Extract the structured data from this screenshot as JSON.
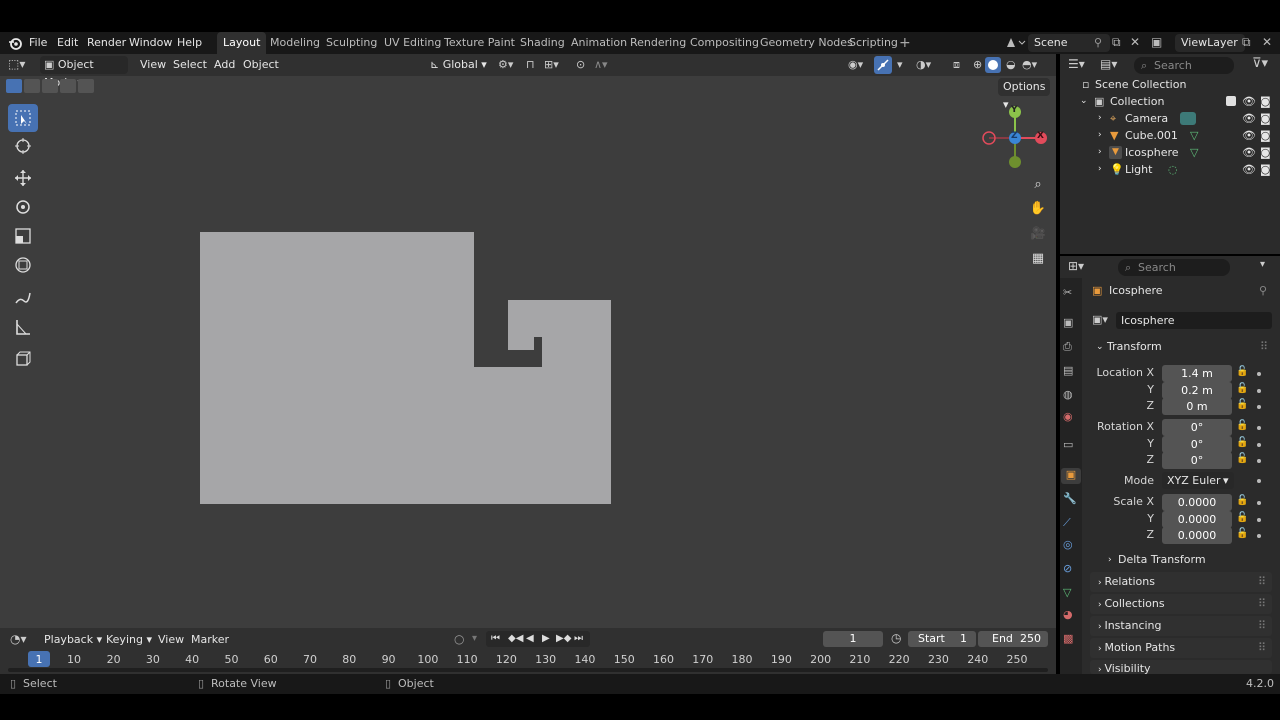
{
  "topmenu": {
    "items": [
      "File",
      "Edit",
      "Render",
      "Window",
      "Help"
    ],
    "workspaces": [
      "Layout",
      "Modeling",
      "Sculpting",
      "UV Editing",
      "Texture Paint",
      "Shading",
      "Animation",
      "Rendering",
      "Compositing",
      "Geometry Nodes",
      "Scripting"
    ],
    "active_workspace": "Layout",
    "scene": "Scene",
    "view_layer": "ViewLayer"
  },
  "viewport": {
    "mode": "Object Mode",
    "menus": [
      "View",
      "Select",
      "Add",
      "Object"
    ],
    "transform_orientation": "Global",
    "options_label": "Options"
  },
  "outliner": {
    "search_placeholder": "Search",
    "scene_collection": "Scene Collection",
    "collection": "Collection",
    "objects": [
      "Camera",
      "Cube.001",
      "Icosphere",
      "Light"
    ]
  },
  "properties": {
    "search_placeholder": "Search",
    "object_name": "Icosphere",
    "data_name": "Icosphere",
    "transform_label": "Transform",
    "location_label": "Location X",
    "location": [
      "1.4 m",
      "0.2 m",
      "0 m"
    ],
    "rotation_label": "Rotation X",
    "rotation": [
      "0°",
      "0°",
      "0°"
    ],
    "mode_label": "Mode",
    "mode_value": "XYZ Euler",
    "scale_label": "Scale X",
    "scale": [
      "0.0000",
      "0.0000",
      "0.0000"
    ],
    "axis_y": "Y",
    "axis_z": "Z",
    "delta_transform": "Delta Transform",
    "panels": [
      "Relations",
      "Collections",
      "Instancing",
      "Motion Paths",
      "Visibility"
    ]
  },
  "timeline": {
    "menus": [
      "Playback",
      "Keying",
      "View",
      "Marker"
    ],
    "current_frame": "1",
    "start_label": "Start",
    "start": "1",
    "end_label": "End",
    "end": "250",
    "ticks": [
      "1",
      "10",
      "20",
      "30",
      "40",
      "50",
      "60",
      "70",
      "80",
      "90",
      "100",
      "110",
      "120",
      "130",
      "140",
      "150",
      "160",
      "170",
      "180",
      "190",
      "200",
      "210",
      "220",
      "230",
      "240",
      "250"
    ]
  },
  "statusbar": {
    "select": "Select",
    "rotate_view": "Rotate View",
    "object": "Object",
    "version": "4.2.0"
  },
  "gizmo": {
    "x": "X",
    "y": "Y",
    "z": "Z"
  },
  "colors": {
    "accent": "#4772b3",
    "object_fill": "#a6a6a8",
    "viewport_bg": "#3d3d3d"
  }
}
